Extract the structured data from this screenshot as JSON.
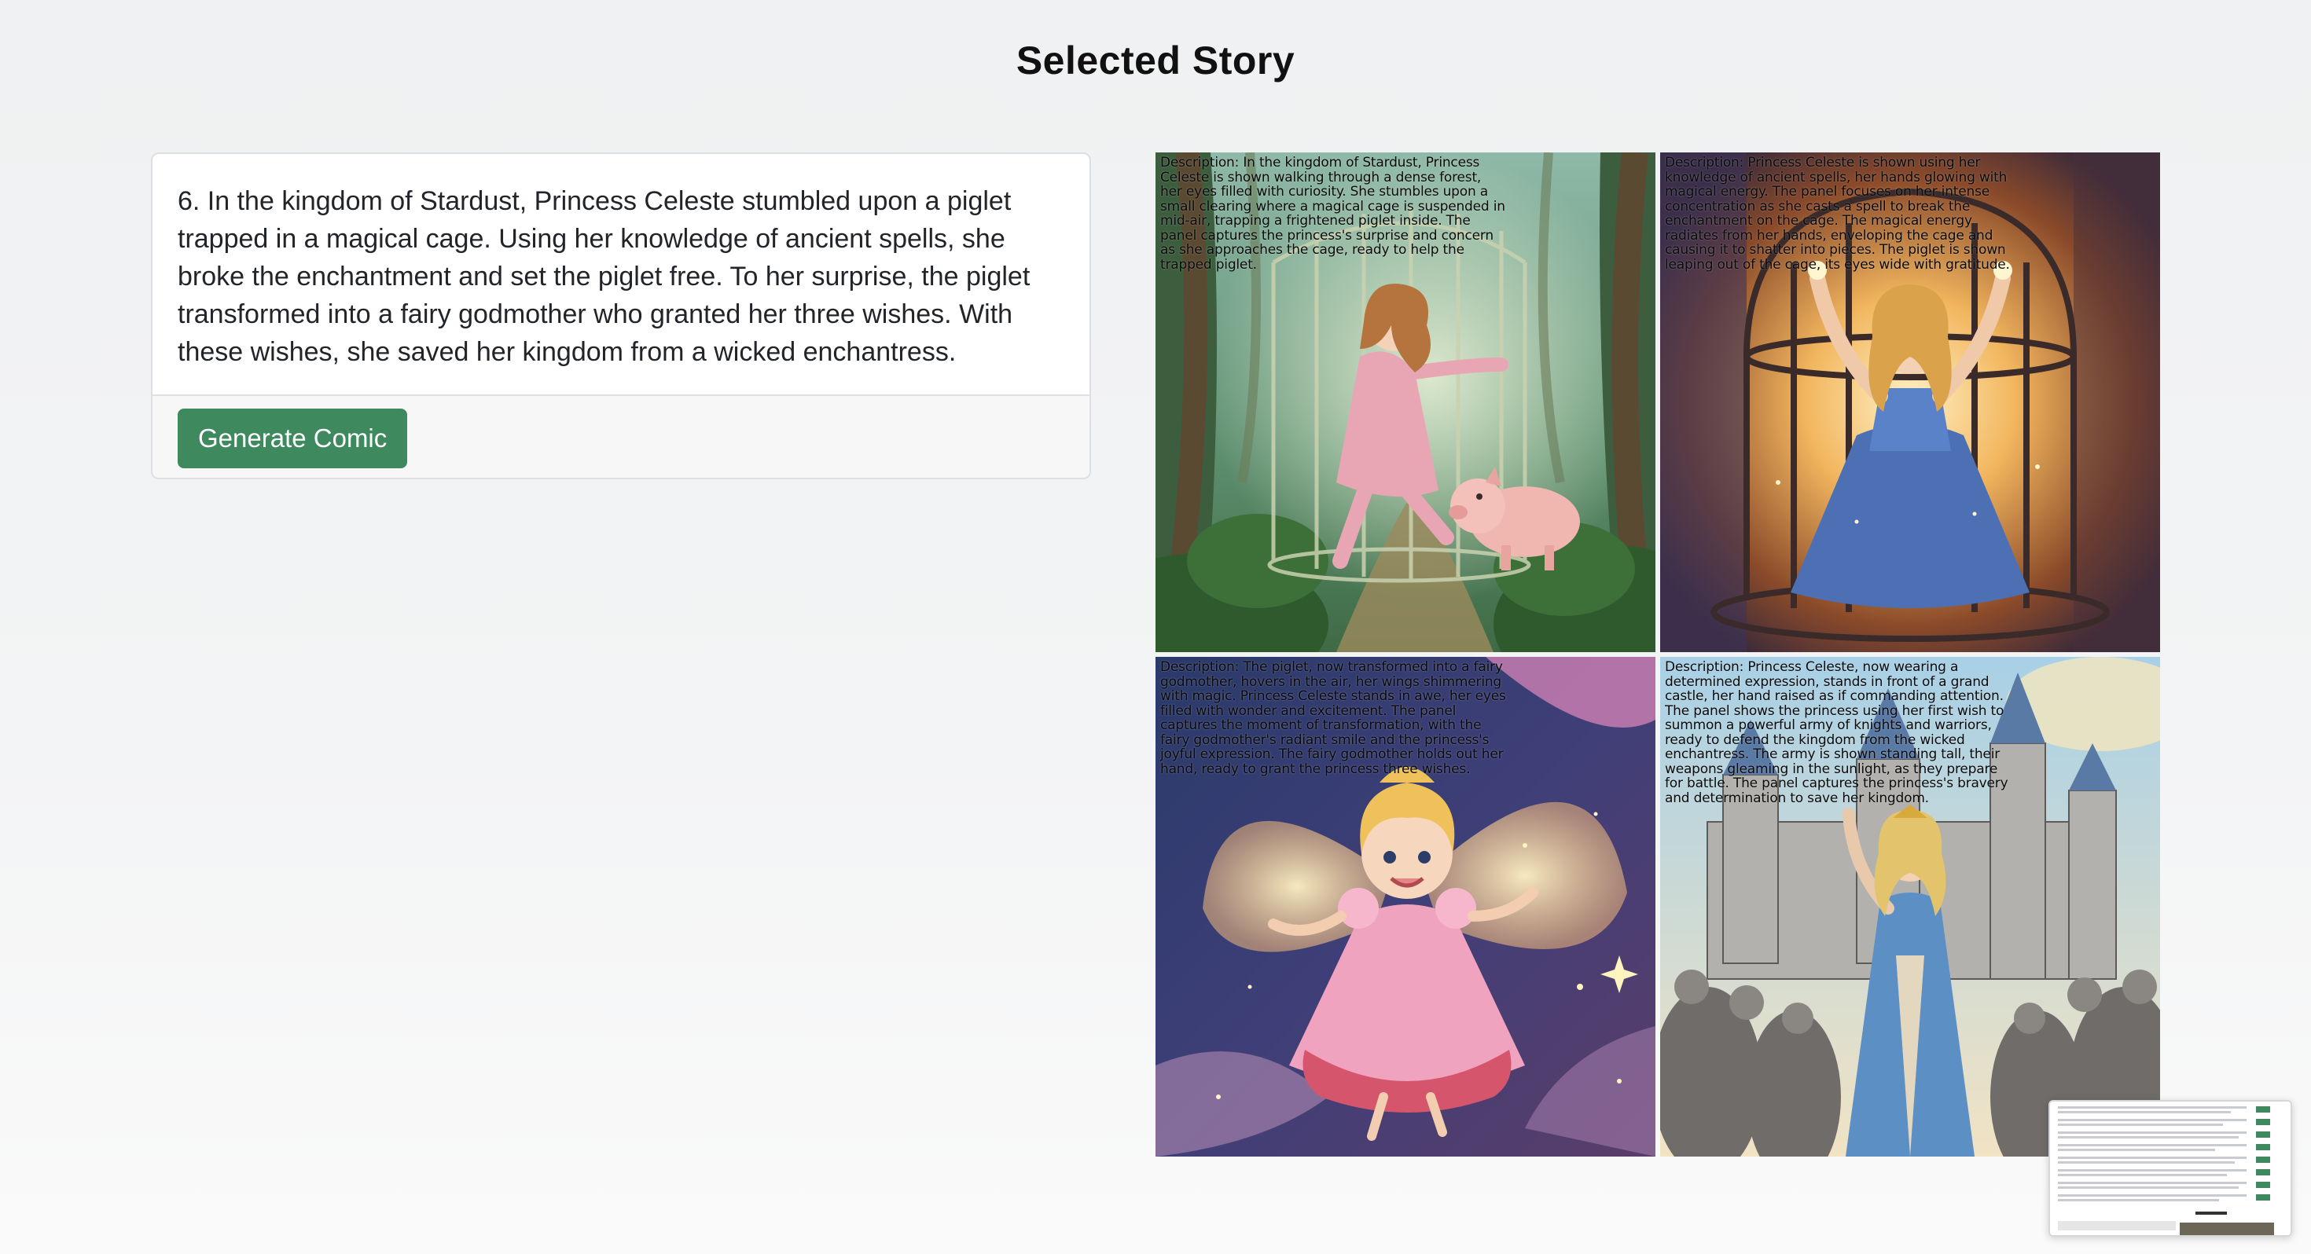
{
  "page": {
    "title": "Selected Story"
  },
  "story": {
    "text": "6. In the kingdom of Stardust, Princess Celeste stumbled upon a piglet trapped in a magical cage. Using her knowledge of ancient spells, she broke the enchantment and set the piglet free. To her surprise, the piglet transformed into a fairy godmother who granted her three wishes. With these wishes, she saved her kingdom from a wicked enchantress.",
    "generate_label": "Generate Comic"
  },
  "colors": {
    "button": "#3e8a5e",
    "title": "#111111",
    "card_border": "#dcdfe3"
  },
  "panels": [
    {
      "caption": "Description: In the kingdom of Stardust, Princess Celeste is shown walking through a dense forest, her eyes filled with curiosity. She stumbles upon a small clearing where a magical cage is suspended in mid-air, trapping a frightened piglet inside. The panel captures the princess's surprise and concern as she approaches the cage, ready to help the trapped piglet."
    },
    {
      "caption": "Description: Princess Celeste is shown using her knowledge of ancient spells, her hands glowing with magical energy. The panel focuses on her intense concentration as she casts a spell to break the enchantment on the cage. The magical energy radiates from her hands, enveloping the cage and causing it to shatter into pieces. The piglet is shown leaping out of the cage, its eyes wide with gratitude."
    },
    {
      "caption": "Description: The piglet, now transformed into a fairy godmother, hovers in the air, her wings shimmering with magic. Princess Celeste stands in awe, her eyes filled with wonder and excitement. The panel captures the moment of transformation, with the fairy godmother's radiant smile and the princess's joyful expression. The fairy godmother holds out her hand, ready to grant the princess three wishes."
    },
    {
      "caption": "Description: Princess Celeste, now wearing a determined expression, stands in front of a grand castle, her hand raised as if commanding attention. The panel shows the princess using her first wish to summon a powerful army of knights and warriors, ready to defend the kingdom from the wicked enchantress. The army is shown standing tall, their weapons gleaming in the sunlight, as they prepare for battle. The panel captures the princess's bravery and determination to save her kingdom."
    }
  ]
}
